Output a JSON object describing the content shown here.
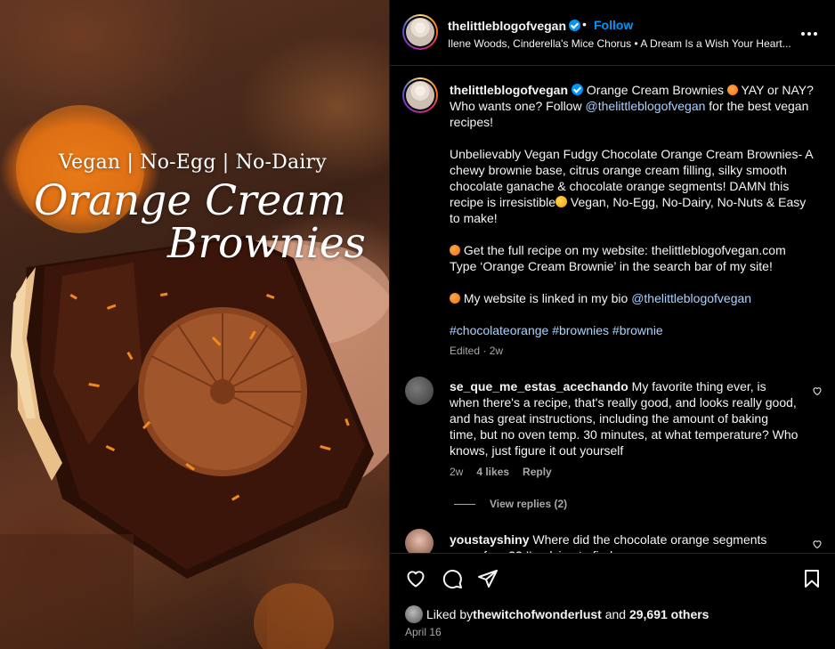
{
  "media": {
    "tagline": "Vegan | No-Egg | No-Dairy",
    "title_line1": "Orange Cream",
    "title_line2": "Brownies"
  },
  "header": {
    "username": "thelittleblogofvegan",
    "separator": "•",
    "follow_label": "Follow",
    "audio": "Ilene Woods, Cinderella's Mice Chorus • A Dream Is a Wish Your Heart..."
  },
  "caption": {
    "username": "thelittleblogofvegan",
    "line1_a": " Orange Cream Brownies ",
    "line1_b": " YAY or NAY? Who wants one? Follow ",
    "mention": "@thelittleblogofvegan",
    "line1_c": " for the best vegan recipes!",
    "para2_a": "Unbelievably Vegan Fudgy Chocolate Orange Cream Brownies- A chewy brownie base, citrus orange cream filling, silky smooth chocolate ganache & chocolate orange segments! DAMN this recipe is irresistible",
    "para2_b": " Vegan, No-Egg, No-Dairy, No-Nuts & Easy to make!",
    "para3_a": "  Get the full recipe on my website: thelittleblogofvegan.com",
    "para3_b": "Type ‘Orange Cream Brownie’ in the search bar of my site!",
    "para4_a": " My website is linked in my bio ",
    "para4_mention": "@thelittleblogofvegan",
    "hashtags": "#chocolateorange #brownies #brownie",
    "meta": "Edited · 2w"
  },
  "comments": [
    {
      "username": "se_que_me_estas_acechando",
      "text": " My favorite thing ever, is when there's a recipe, that's really good, and looks really good, and has great instructions, including the amount of baking time, but no oven temp. 30 minutes, at what temperature? Who knows, just figure it out yourself",
      "time": "2w",
      "likes": "4 likes",
      "reply": "Reply",
      "view_replies": "View replies (2)"
    },
    {
      "username": "youstayshiny",
      "text": " Where did the chocolate orange segments come from?? I'm dying to find some..."
    }
  ],
  "footer": {
    "liked_by_prefix": "Liked by ",
    "liked_by_user": "thewitchofwonderlust",
    "liked_by_mid": " and ",
    "liked_by_count": "29,691 others",
    "date": "April 16"
  },
  "colors": {
    "accent": "#0095f6",
    "link": "#a8d2ff",
    "muted": "#a8a8a8",
    "background": "#000000"
  },
  "icons": [
    "verified-badge-icon",
    "more-options-icon",
    "heart-icon",
    "comment-icon",
    "share-icon",
    "bookmark-icon",
    "orange-emoji-icon",
    "heart-eyes-emoji-icon"
  ]
}
